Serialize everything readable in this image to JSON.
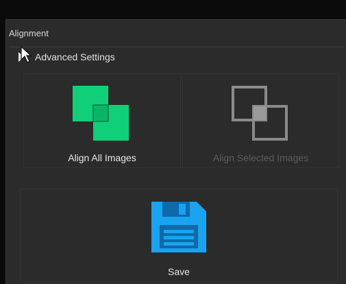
{
  "section": {
    "title": "Alignment",
    "advanced_settings_label": "Advanced Settings"
  },
  "buttons": {
    "align_all": {
      "label": "Align All Images",
      "icon": "align-all-icon",
      "color": "#0fcf78",
      "enabled": true
    },
    "align_selected": {
      "label": "Align Selected Images",
      "icon": "align-selected-icon",
      "enabled": false
    },
    "save": {
      "label": "Save",
      "icon": "floppy-disk-icon",
      "color": "#1aa3f0",
      "enabled": true
    }
  }
}
